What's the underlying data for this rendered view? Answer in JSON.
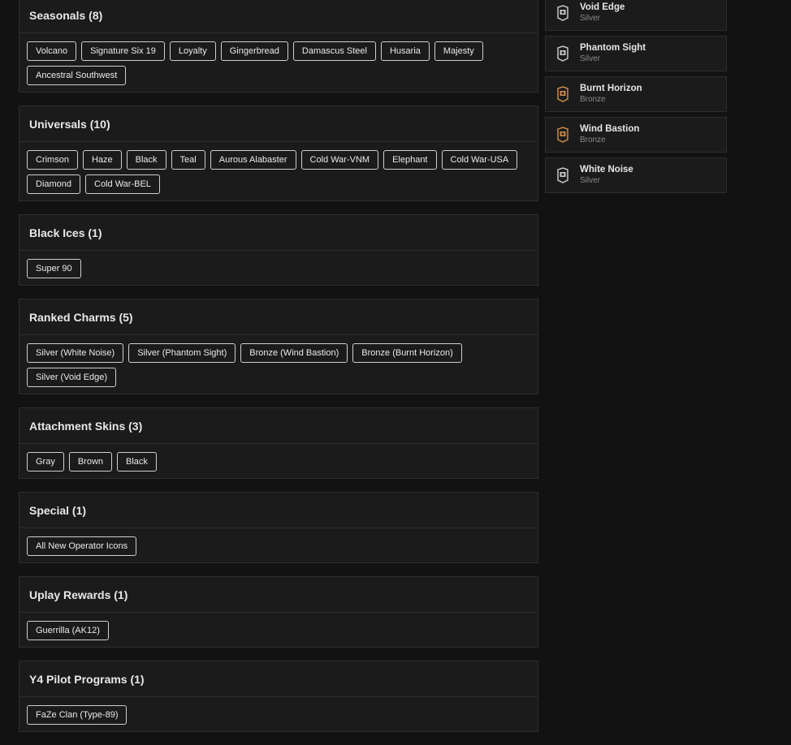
{
  "sections": [
    {
      "title": "Seasonals (8)",
      "items": [
        "Volcano",
        "Signature Six 19",
        "Loyalty",
        "Gingerbread",
        "Damascus Steel",
        "Husaria",
        "Majesty",
        "Ancestral Southwest"
      ]
    },
    {
      "title": "Universals (10)",
      "items": [
        "Crimson",
        "Haze",
        "Black",
        "Teal",
        "Aurous Alabaster",
        "Cold War-VNM",
        "Elephant",
        "Cold War-USA",
        "Diamond",
        "Cold War-BEL"
      ]
    },
    {
      "title": "Black Ices (1)",
      "items": [
        "Super 90"
      ]
    },
    {
      "title": "Ranked Charms (5)",
      "items": [
        "Silver (White Noise)",
        "Silver (Phantom Sight)",
        "Bronze (Wind Bastion)",
        "Bronze (Burnt Horizon)",
        "Silver (Void Edge)"
      ]
    },
    {
      "title": "Attachment Skins (3)",
      "items": [
        "Gray",
        "Brown",
        "Black"
      ]
    },
    {
      "title": "Special (1)",
      "items": [
        "All New Operator Icons"
      ]
    },
    {
      "title": "Uplay Rewards (1)",
      "items": [
        "Guerrilla (AK12)"
      ]
    },
    {
      "title": "Y4 Pilot Programs (1)",
      "items": [
        "FaZe Clan (Type-89)"
      ]
    }
  ],
  "charms": [
    {
      "name": "Void Edge",
      "rank": "Silver",
      "icon": "silver-rank-icon",
      "color": "#c8c8c8"
    },
    {
      "name": "Phantom Sight",
      "rank": "Silver",
      "icon": "silver-rank-icon",
      "color": "#c8c8c8"
    },
    {
      "name": "Burnt Horizon",
      "rank": "Bronze",
      "icon": "bronze-rank-icon",
      "color": "#c98a4b"
    },
    {
      "name": "Wind Bastion",
      "rank": "Bronze",
      "icon": "bronze-rank-icon",
      "color": "#c98a4b"
    },
    {
      "name": "White Noise",
      "rank": "Silver",
      "icon": "silver-rank-icon",
      "color": "#c8c8c8"
    }
  ]
}
